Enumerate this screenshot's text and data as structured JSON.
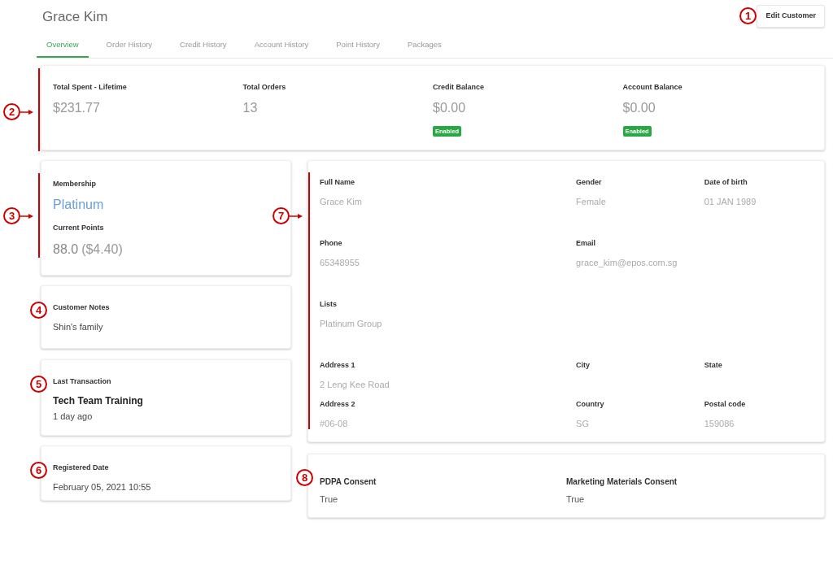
{
  "header": {
    "title": "Grace Kim",
    "button": "Edit Customer",
    "callout": {
      "number": "1"
    }
  },
  "tabs": [
    {
      "label": "Overview",
      "selected": true
    },
    {
      "label": "Order History",
      "selected": false
    },
    {
      "label": "Credit History",
      "selected": false
    },
    {
      "label": "Account History",
      "selected": false
    },
    {
      "label": "Point History",
      "selected": false
    },
    {
      "label": "Packages",
      "selected": false
    }
  ],
  "summary": {
    "callout": {
      "number": "2",
      "bar": true
    },
    "stats": [
      {
        "label": "Total Spent - Lifetime",
        "value": "$231.77"
      },
      {
        "label": "Total Orders",
        "value": "13"
      },
      {
        "label": "Credit Balance",
        "value": "$0.00",
        "badge": "Enabled"
      },
      {
        "label": "Account Balance",
        "value": "$0.00",
        "badge": "Enabled"
      }
    ]
  },
  "membership": {
    "callout": {
      "number": "3",
      "bar": true
    },
    "label": "Membership",
    "tier": "Platinum",
    "points_label": "Current Points",
    "points": "88.0",
    "points_value": "($4.40)"
  },
  "notes": {
    "callout": {
      "number": "4"
    },
    "label": "Customer Notes",
    "text": "Shin's family"
  },
  "last_transaction": {
    "callout": {
      "number": "5"
    },
    "label": "Last Transaction",
    "name": "Tech Team Training",
    "time": "1 day ago"
  },
  "registered": {
    "callout": {
      "number": "6"
    },
    "label": "Registered Date",
    "date": "February 05, 2021 10:55"
  },
  "details": {
    "callout": {
      "number": "7",
      "bar": true
    },
    "rows": [
      [
        {
          "label": "Full Name",
          "value": "Grace Kim"
        },
        {
          "label": "Gender",
          "value": "Female"
        },
        {
          "label": "Date of birth",
          "value": "01 JAN 1989"
        }
      ],
      [
        {
          "label": "Phone",
          "value": "65348955"
        },
        {
          "label": "Email",
          "value": "grace_kim@epos.com.sg"
        }
      ],
      [
        {
          "label": "Lists",
          "value": "Platinum Group"
        }
      ],
      [
        {
          "label": "Address 1",
          "value": "2 Leng Kee Road"
        },
        {
          "label": "City"
        },
        {
          "label": "State"
        }
      ],
      [
        {
          "label": "Address 2",
          "value": "#06-08"
        },
        {
          "label": "Country",
          "value": "SG"
        },
        {
          "label": "Postal code",
          "value": "159086"
        }
      ]
    ]
  },
  "consent": {
    "callout": {
      "number": "8"
    },
    "items": [
      {
        "label": "PDPA Consent",
        "value": "True"
      },
      {
        "label": "Marketing Materials Consent",
        "value": "True"
      }
    ]
  }
}
